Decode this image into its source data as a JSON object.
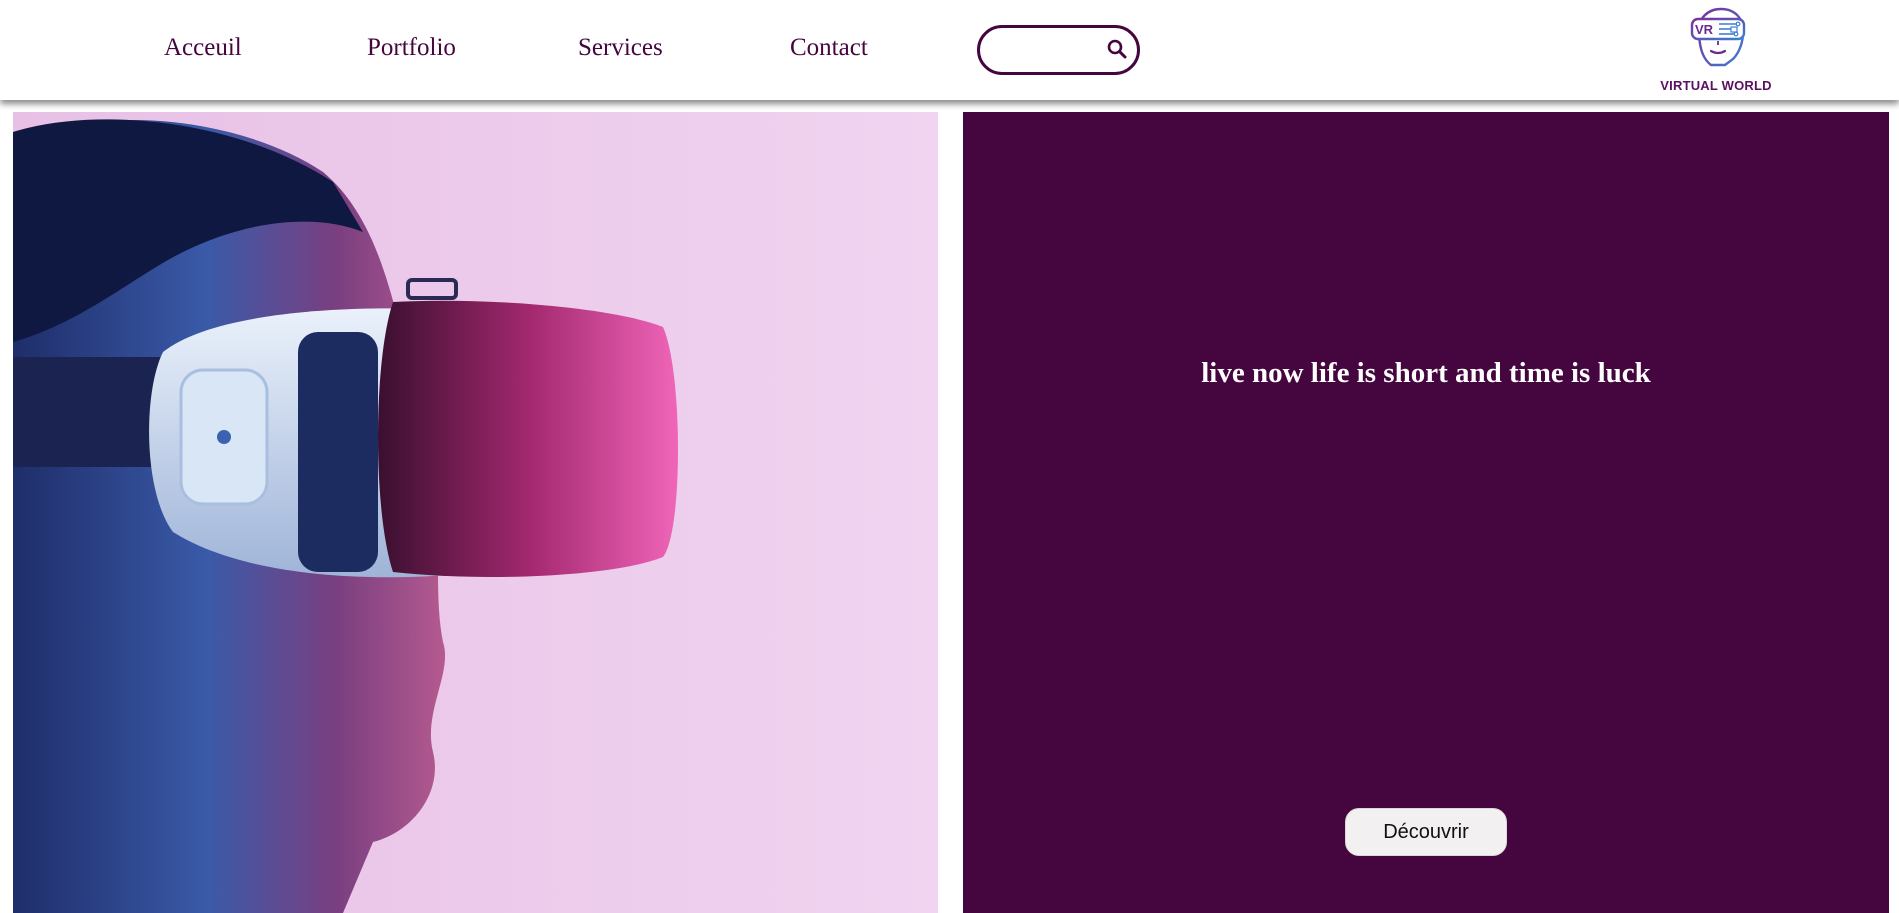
{
  "nav": {
    "items": [
      {
        "label": "Acceuil"
      },
      {
        "label": "Portfolio"
      },
      {
        "label": "Services"
      },
      {
        "label": "Contact"
      }
    ],
    "search": {
      "value": "",
      "placeholder": ""
    }
  },
  "logo": {
    "badge_text": "VR",
    "name": "VIRTUAL WORLD"
  },
  "hero": {
    "tagline": "live now life is short and time is luck",
    "button_label": "Découvrir"
  },
  "colors": {
    "brand": "#45053f",
    "image_background": "#ecc8ea",
    "button_background": "#f2f0f0"
  },
  "icons": {
    "search": "search-icon",
    "logo": "vr-headset-face-logo"
  }
}
